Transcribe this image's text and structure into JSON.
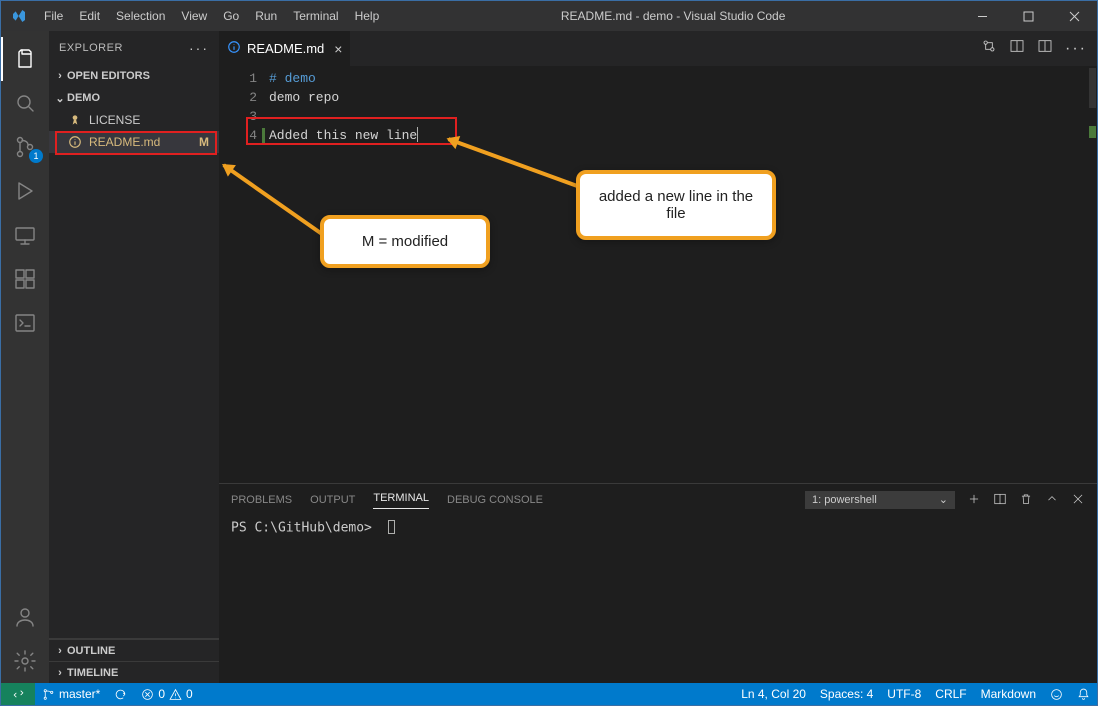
{
  "titlebar": {
    "menus": [
      "File",
      "Edit",
      "Selection",
      "View",
      "Go",
      "Run",
      "Terminal",
      "Help"
    ],
    "title": "README.md - demo - Visual Studio Code"
  },
  "activity": {
    "scm_badge": "1"
  },
  "explorer": {
    "title": "EXPLORER",
    "open_editors": "OPEN EDITORS",
    "folder": "DEMO",
    "files": {
      "license": "LICENSE",
      "readme": "README.md",
      "readme_status": "M"
    },
    "outline": "OUTLINE",
    "timeline": "TIMELINE"
  },
  "tabs": {
    "readme": "README.md"
  },
  "editor": {
    "lines": {
      "n1": "1",
      "n2": "2",
      "n3": "3",
      "n4": "4",
      "l1": "# demo",
      "l2": "demo repo",
      "l3": "",
      "l4": "Added this new line"
    }
  },
  "panel": {
    "tabs": {
      "problems": "PROBLEMS",
      "output": "OUTPUT",
      "terminal": "TERMINAL",
      "debug": "DEBUG CONSOLE"
    },
    "term_name": "1: powershell",
    "prompt": "PS C:\\GitHub\\demo>"
  },
  "status": {
    "branch": "master*",
    "sync": "",
    "errors": "0",
    "warnings": "0",
    "lncol": "Ln 4, Col 20",
    "spaces": "Spaces: 4",
    "encoding": "UTF-8",
    "eol": "CRLF",
    "lang": "Markdown"
  },
  "callouts": {
    "modified": "M = modified",
    "newline": "added a new line in the file"
  }
}
